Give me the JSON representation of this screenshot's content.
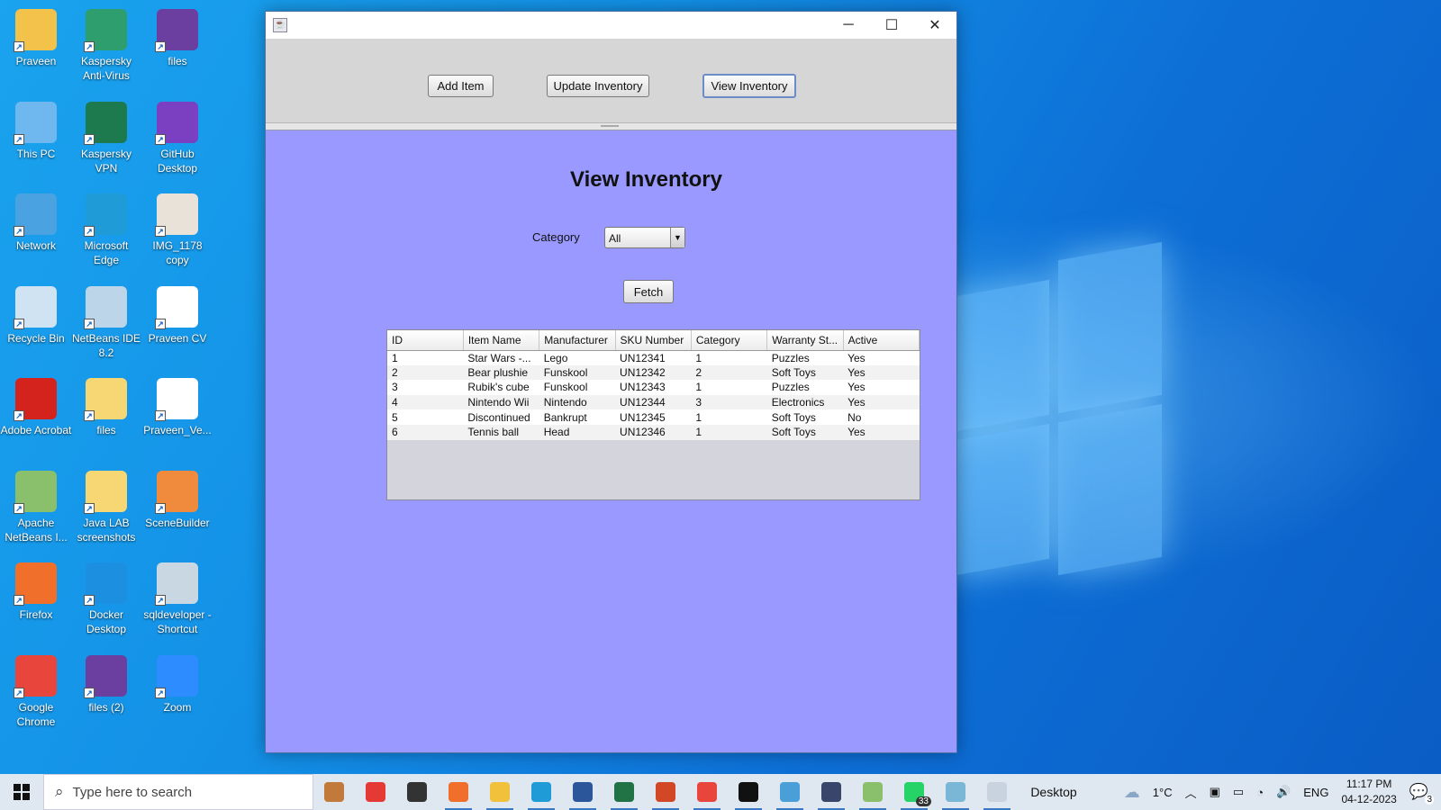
{
  "desktop": {
    "icons": [
      {
        "label": "Praveen",
        "icon": "user-folder-icon",
        "color": "#f3c24b"
      },
      {
        "label": "Kaspersky Anti-Virus",
        "icon": "kaspersky-antivirus-icon",
        "color": "#2f9e6e"
      },
      {
        "label": "files",
        "icon": "winrar-archive-icon",
        "color": "#6a3fa0"
      },
      {
        "label": "This PC",
        "icon": "this-pc-icon",
        "color": "#6fb7ef"
      },
      {
        "label": "Kaspersky VPN",
        "icon": "kaspersky-vpn-icon",
        "color": "#1d7a4f"
      },
      {
        "label": "GitHub Desktop",
        "icon": "github-desktop-icon",
        "color": "#7b3fc1"
      },
      {
        "label": "Network",
        "icon": "network-icon",
        "color": "#4aa3e0"
      },
      {
        "label": "Microsoft Edge",
        "icon": "edge-icon",
        "color": "#1f9bd8"
      },
      {
        "label": "IMG_1178 copy",
        "icon": "photo-icon",
        "color": "#e9e2d8"
      },
      {
        "label": "Recycle Bin",
        "icon": "recycle-bin-icon",
        "color": "#cfe3f2"
      },
      {
        "label": "NetBeans IDE 8.2",
        "icon": "netbeans-icon",
        "color": "#bcd5e8"
      },
      {
        "label": "Praveen CV",
        "icon": "pdf-icon",
        "color": "#ffffff"
      },
      {
        "label": "Adobe Acrobat",
        "icon": "adobe-acrobat-icon",
        "color": "#d4231d"
      },
      {
        "label": "files",
        "icon": "folder-icon",
        "color": "#f7d774"
      },
      {
        "label": "Praveen_Ve...",
        "icon": "word-document-icon",
        "color": "#ffffff"
      },
      {
        "label": "Apache NetBeans I...",
        "icon": "apache-netbeans-icon",
        "color": "#8ac06b"
      },
      {
        "label": "Java LAB screenshots",
        "icon": "folder-icon",
        "color": "#f7d774"
      },
      {
        "label": "SceneBuilder",
        "icon": "scenebuilder-icon",
        "color": "#f08a3c"
      },
      {
        "label": "Firefox",
        "icon": "firefox-icon",
        "color": "#f0702b"
      },
      {
        "label": "Docker Desktop",
        "icon": "docker-icon",
        "color": "#1d8fe0"
      },
      {
        "label": "sqldeveloper - Shortcut",
        "icon": "sqldeveloper-icon",
        "color": "#c9d7e3"
      },
      {
        "label": "Google Chrome",
        "icon": "chrome-icon",
        "color": "#e8453c"
      },
      {
        "label": "files (2)",
        "icon": "winrar-archive-icon",
        "color": "#6a3fa0"
      },
      {
        "label": "Zoom",
        "icon": "zoom-icon",
        "color": "#2d8cff"
      }
    ]
  },
  "window": {
    "title": "",
    "controls": {
      "minimize": "─",
      "maximize": "☐",
      "close": "✕"
    },
    "toolbar": {
      "add_item": "Add Item",
      "update_inventory": "Update Inventory",
      "view_inventory": "View Inventory"
    },
    "main": {
      "title": "View Inventory",
      "category_label": "Category",
      "category_value": "All",
      "fetch_button": "Fetch",
      "table": {
        "columns": [
          "ID",
          "Item Name",
          "Manufacturer",
          "SKU Number",
          "Category",
          "Warranty St...",
          "Active"
        ],
        "rows": [
          [
            "1",
            "Star Wars -...",
            "Lego",
            "UN12341",
            "1",
            "Puzzles",
            "Yes"
          ],
          [
            "2",
            "Bear plushie",
            "Funskool",
            "UN12342",
            "2",
            "Soft Toys",
            "Yes"
          ],
          [
            "3",
            "Rubik's cube",
            "Funskool",
            "UN12343",
            "1",
            "Puzzles",
            "Yes"
          ],
          [
            "4",
            "Nintendo Wii",
            "Nintendo",
            "UN12344",
            "3",
            "Electronics",
            "Yes"
          ],
          [
            "5",
            "Discontinued",
            "Bankrupt",
            "UN12345",
            "1",
            "Soft Toys",
            "No"
          ],
          [
            "6",
            "Tennis ball",
            "Head",
            "UN12346",
            "1",
            "Soft Toys",
            "Yes"
          ]
        ]
      }
    }
  },
  "taskbar": {
    "search_placeholder": "Type here to search",
    "apps": [
      {
        "icon": "gingerbread-icon",
        "color": "#c27a3a"
      },
      {
        "icon": "record-icon",
        "color": "#e53935"
      },
      {
        "icon": "task-view-icon",
        "color": "#333333"
      },
      {
        "icon": "firefox-icon",
        "color": "#f0702b"
      },
      {
        "icon": "file-explorer-icon",
        "color": "#f2c13c"
      },
      {
        "icon": "edge-icon",
        "color": "#1f9bd8"
      },
      {
        "icon": "word-icon",
        "color": "#2b579a"
      },
      {
        "icon": "excel-icon",
        "color": "#217346"
      },
      {
        "icon": "powerpoint-icon",
        "color": "#d24726"
      },
      {
        "icon": "chrome-icon",
        "color": "#e8453c"
      },
      {
        "icon": "terminal-icon",
        "color": "#111111"
      },
      {
        "icon": "media-player-icon",
        "color": "#4a9fd8"
      },
      {
        "icon": "visual-studio-icon",
        "color": "#39456b"
      },
      {
        "icon": "netbeans-icon",
        "color": "#8ac06b"
      },
      {
        "icon": "whatsapp-icon",
        "color": "#25d366"
      },
      {
        "icon": "notepad-icon",
        "color": "#7ab7d6"
      },
      {
        "icon": "java-app-icon",
        "color": "#c9d3df"
      }
    ],
    "whatsapp_badge": "33",
    "desktop_label": "Desktop",
    "weather": "1°C",
    "language": "ENG",
    "time": "11:17 PM",
    "date": "04-12-2023",
    "notification_count": "3"
  }
}
